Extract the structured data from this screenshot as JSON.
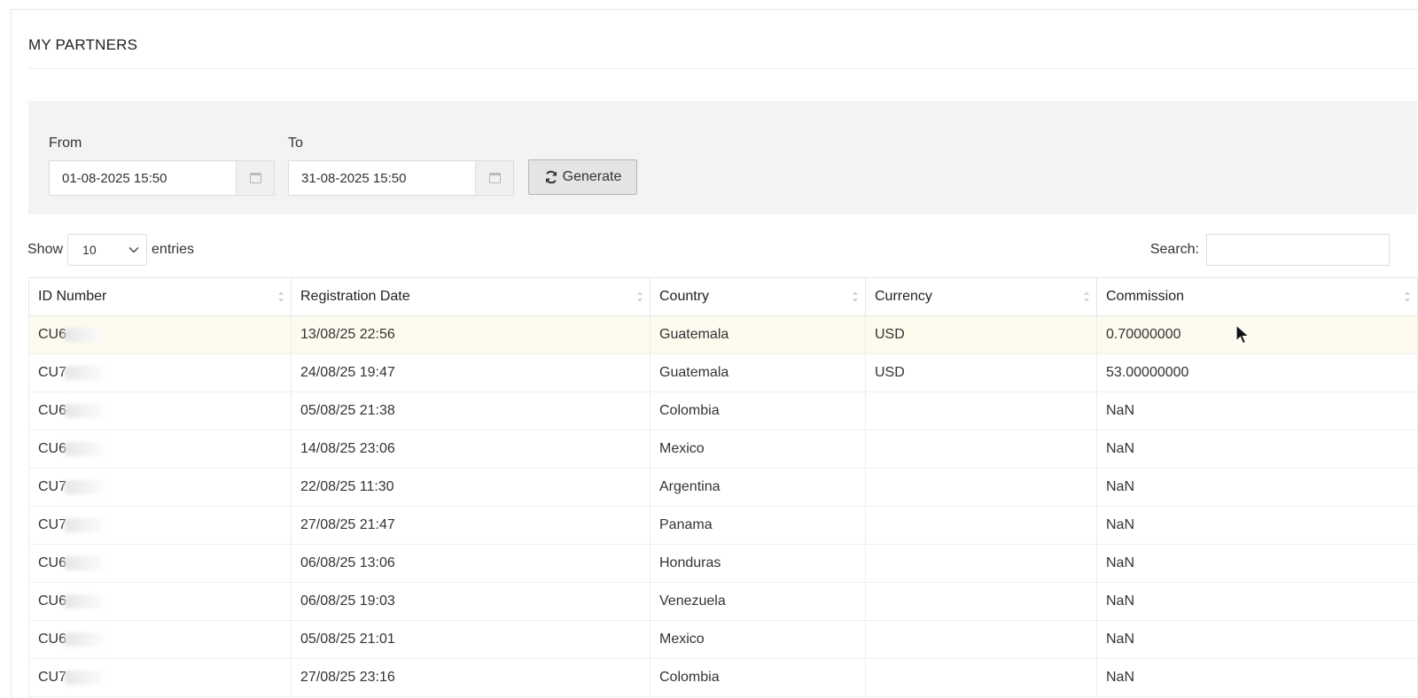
{
  "panel": {
    "title": "MY PARTNERS"
  },
  "filter": {
    "from_label": "From",
    "from_value": "01-08-2025 15:50",
    "to_label": "To",
    "to_value": "31-08-2025 15:50",
    "generate_label": "Generate"
  },
  "length": {
    "show_label": "Show",
    "selected": "10",
    "entries_label": "entries"
  },
  "search": {
    "label": "Search:",
    "value": ""
  },
  "table": {
    "headers": [
      "ID Number",
      "Registration Date",
      "Country",
      "Currency",
      "Commission"
    ],
    "rows": [
      {
        "id": "CU6",
        "date": "13/08/25 22:56",
        "country": "Guatemala",
        "currency": "USD",
        "commission": "0.70000000"
      },
      {
        "id": "CU7",
        "date": "24/08/25 19:47",
        "country": "Guatemala",
        "currency": "USD",
        "commission": "53.00000000"
      },
      {
        "id": "CU6",
        "date": "05/08/25 21:38",
        "country": "Colombia",
        "currency": "",
        "commission": "NaN"
      },
      {
        "id": "CU6",
        "date": "14/08/25 23:06",
        "country": "Mexico",
        "currency": "",
        "commission": "NaN"
      },
      {
        "id": "CU7",
        "date": "22/08/25 11:30",
        "country": "Argentina",
        "currency": "",
        "commission": "NaN"
      },
      {
        "id": "CU7",
        "date": "27/08/25 21:47",
        "country": "Panama",
        "currency": "",
        "commission": "NaN"
      },
      {
        "id": "CU6",
        "date": "06/08/25 13:06",
        "country": "Honduras",
        "currency": "",
        "commission": "NaN"
      },
      {
        "id": "CU6",
        "date": "06/08/25 19:03",
        "country": "Venezuela",
        "currency": "",
        "commission": "NaN"
      },
      {
        "id": "CU6",
        "date": "05/08/25 21:01",
        "country": "Mexico",
        "currency": "",
        "commission": "NaN"
      },
      {
        "id": "CU7",
        "date": "27/08/25 23:16",
        "country": "Colombia",
        "currency": "",
        "commission": "NaN"
      }
    ]
  },
  "icons": {
    "calendar": "calendar-icon",
    "refresh": "refresh-icon",
    "sort": "sort-icon",
    "chevron": "chevron-down-icon",
    "cursor": "mouse-cursor-icon"
  },
  "colors": {
    "filter_bg": "#f3f3f3",
    "highlight_row": "#fdfbee",
    "button_bg": "#e4e4e4"
  }
}
